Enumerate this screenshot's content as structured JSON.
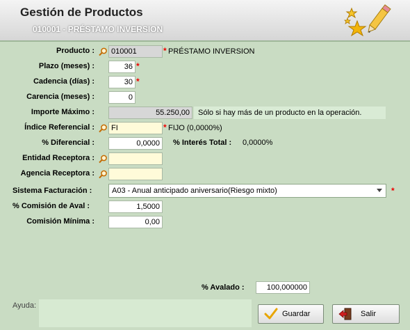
{
  "header": {
    "title": "Gestión de Productos",
    "subtitle": "010001 - PRÉSTAMO INVERSION"
  },
  "fields": {
    "producto": {
      "label": "Producto :",
      "code": "010001",
      "description": "PRÉSTAMO INVERSION"
    },
    "plazo": {
      "label": "Plazo (meses) :",
      "value": "36"
    },
    "cadencia": {
      "label": "Cadencia (días) :",
      "value": "30"
    },
    "carencia": {
      "label": "Carencia (meses) :",
      "value": "0"
    },
    "importe_maximo": {
      "label": "Importe Máximo :",
      "value": "55.250,00",
      "hint": "Sólo si hay más de un producto en la operación."
    },
    "indice_referencial": {
      "label": "Índice Referencial :",
      "value": "FI",
      "description": "FIJO (0,0000%)"
    },
    "diferencial": {
      "label": "% Diferencial :",
      "value": "0,0000"
    },
    "interes_total": {
      "label": "% Interés Total :",
      "value": "0,0000%"
    },
    "entidad_receptora": {
      "label": "Entidad Receptora :",
      "value": ""
    },
    "agencia_receptora": {
      "label": "Agencia Receptora :",
      "value": ""
    },
    "sistema_facturacion": {
      "label": "Sistema Facturación :",
      "value": "A03 - Anual anticipado aniversario(Riesgo mixto)"
    },
    "comision_aval": {
      "label": "% Comisión de Aval :",
      "value": "1,5000"
    },
    "comision_minima": {
      "label": "Comisión Mínima :",
      "value": "0,00"
    },
    "avalado": {
      "label": "% Avalado :",
      "value": "100,000000"
    }
  },
  "required_marker": "*",
  "help": {
    "label": "Ayuda:"
  },
  "buttons": {
    "save": "Guardar",
    "exit": "Salir"
  },
  "icons": {
    "search": "magnifier-icon",
    "logo": "stars-pencil-icon",
    "save": "checkmark-icon",
    "exit": "exit-door-icon"
  },
  "colors": {
    "background": "#c9dcc3",
    "required": "#e00000",
    "lookup_field": "#fffbd9",
    "readonly_field": "#d7d7d7"
  }
}
